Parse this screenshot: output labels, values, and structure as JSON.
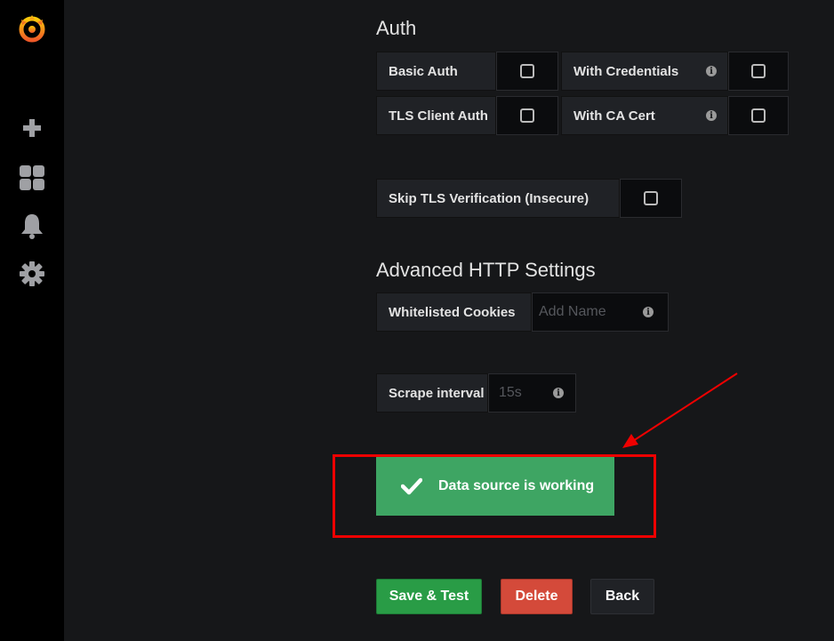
{
  "sidebar": {
    "icons": [
      "grafana-logo-icon",
      "plus-icon",
      "dashboards-icon",
      "bell-icon",
      "gear-icon"
    ]
  },
  "auth": {
    "title": "Auth",
    "basic_auth": "Basic Auth",
    "with_credentials": "With Credentials",
    "tls_client_auth": "TLS Client Auth",
    "with_ca_cert": "With CA Cert",
    "skip_tls": "Skip TLS Verification (Insecure)"
  },
  "advanced": {
    "title": "Advanced HTTP Settings",
    "whitelisted_cookies": "Whitelisted Cookies",
    "cookies_placeholder": "Add Name",
    "scrape_interval": "Scrape interval",
    "scrape_placeholder": "15s"
  },
  "status": {
    "message": "Data source is working",
    "color": "#3ea563"
  },
  "buttons": {
    "save_test": "Save & Test",
    "delete": "Delete",
    "back": "Back"
  },
  "colors": {
    "save": "#299c46",
    "delete": "#d44a3a",
    "back": "#202226",
    "highlight": "#e00000"
  }
}
